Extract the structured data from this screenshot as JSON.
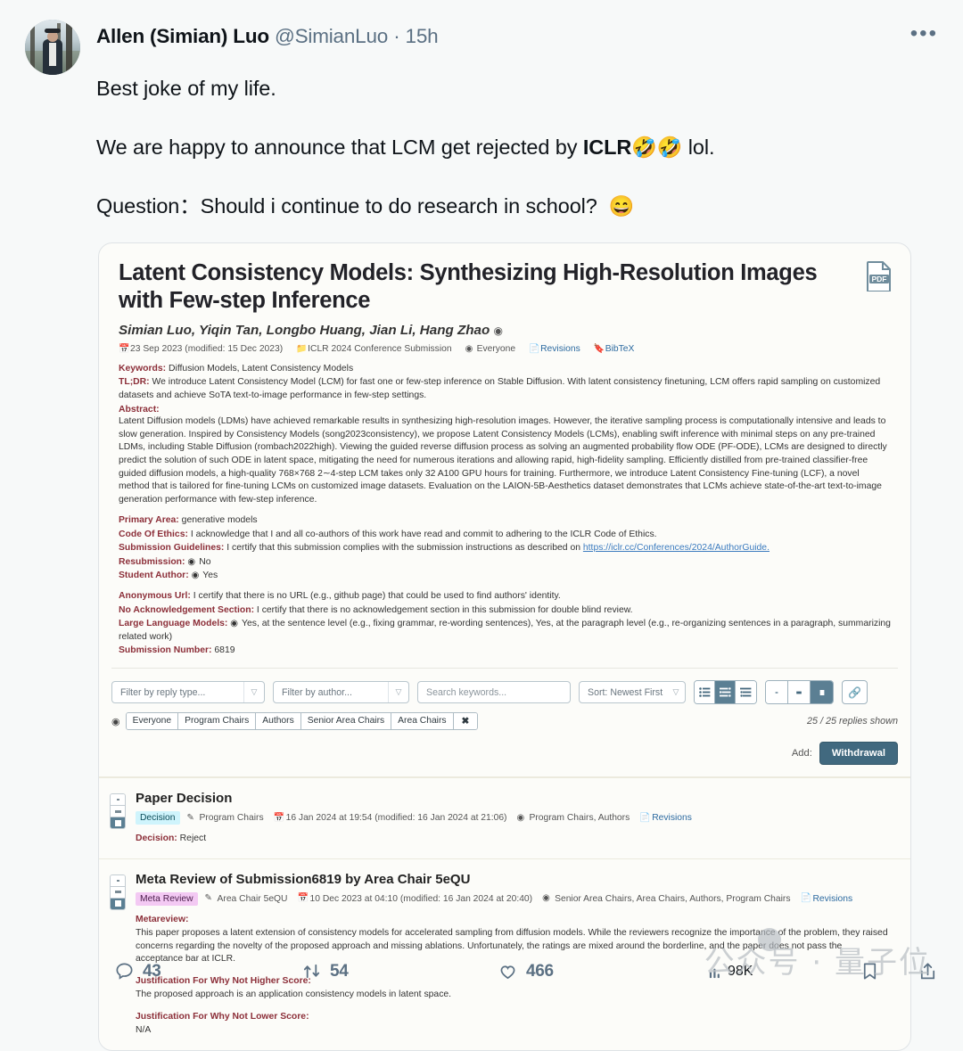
{
  "tweet": {
    "author_name": "Allen (Simian) Luo",
    "handle": "@SimianLuo",
    "separator": "·",
    "timestamp": "15h",
    "more_label": "•••",
    "line1": "Best joke of my life.",
    "line2_prefix": "We are happy to announce that LCM get rejected by ",
    "line2_bold": "ICLR",
    "line2_emoji": "🤣🤣",
    "line2_suffix": " lol.",
    "line3": "Question：Should i continue to do research in school?",
    "line3_emoji": "😄"
  },
  "paper": {
    "title": "Latent Consistency Models: Synthesizing High-Resolution Images with Few-step Inference",
    "authors": "Simian Luo, Yiqin Tan, Longbo Huang, Jian Li, Hang Zhao",
    "pdf_label": "PDF",
    "meta": {
      "date": "23 Sep 2023 (modified: 15 Dec 2023)",
      "venue": "ICLR 2024 Conference Submission",
      "readers": "Everyone",
      "revisions": "Revisions",
      "bibtex": "BibTeX"
    },
    "fields": [
      {
        "key": "Keywords:",
        "value": "Diffusion Models, Latent Consistency Models"
      },
      {
        "key": "TL;DR:",
        "value": "We introduce Latent Consistency Model (LCM) for fast one or few-step inference on Stable Diffusion. With latent consistency finetuning, LCM offers rapid sampling on customized datasets and achieve SoTA text-to-image performance in few-step settings."
      }
    ],
    "abstract_label": "Abstract:",
    "abstract": "Latent Diffusion models (LDMs) have achieved remarkable results in synthesizing high-resolution images. However, the iterative sampling process is computationally intensive and leads to slow generation. Inspired by Consistency Models (song2023consistency), we propose Latent Consistency Models (LCMs), enabling swift inference with minimal steps on any pre-trained LDMs, including Stable Diffusion (rombach2022high). Viewing the guided reverse diffusion process as solving an augmented probability flow ODE (PF-ODE), LCMs are designed to directly predict the solution of such ODE in latent space, mitigating the need for numerous iterations and allowing rapid, high-fidelity sampling. Efficiently distilled from pre-trained classifier-free guided diffusion models, a high-quality 768×768 2∼4-step LCM takes only 32 A100 GPU hours for training. Furthermore, we introduce Latent Consistency Fine-tuning (LCF), a novel method that is tailored for fine-tuning LCMs on customized image datasets. Evaluation on the LAION-5B-Aesthetics dataset demonstrates that LCMs achieve state-of-the-art text-to-image generation performance with few-step inference.",
    "fields2": [
      {
        "key": "Primary Area:",
        "value": "generative models"
      },
      {
        "key": "Code Of Ethics:",
        "value": "I acknowledge that I and all co-authors of this work have read and commit to adhering to the ICLR Code of Ethics."
      },
      {
        "key": "Submission Guidelines:",
        "value": "I certify that this submission complies with the submission instructions as described on ",
        "link": "https://iclr.cc/Conferences/2024/AuthorGuide."
      },
      {
        "key": "Resubmission:",
        "value": "No",
        "eye": true
      },
      {
        "key": "Student Author:",
        "value": "Yes",
        "eye": true
      }
    ],
    "fields3": [
      {
        "key": "Anonymous Url:",
        "value": "I certify that there is no URL (e.g., github page) that could be used to find authors' identity."
      },
      {
        "key": "No Acknowledgement Section:",
        "value": "I certify that there is no acknowledgement section in this submission for double blind review."
      },
      {
        "key": "Large Language Models:",
        "value": "Yes, at the sentence level (e.g., fixing grammar, re-wording sentences), Yes, at the paragraph level (e.g., re-organizing sentences in a paragraph, summarizing related work)",
        "eye": true
      },
      {
        "key": "Submission Number:",
        "value": "6819"
      }
    ]
  },
  "toolbar": {
    "filter_reply_type_placeholder": "Filter by reply type...",
    "filter_author_placeholder": "Filter by author...",
    "search_placeholder": "Search keywords...",
    "sort_value": "Sort: Newest First",
    "chips": [
      "Everyone",
      "Program Chairs",
      "Authors",
      "Senior Area Chairs",
      "Area Chairs"
    ],
    "chip_clear": "✖",
    "replies_shown": "25 / 25 replies shown",
    "add_label": "Add:",
    "withdrawal_label": "Withdrawal"
  },
  "discussion": [
    {
      "title": "Paper Decision",
      "badge": "Decision",
      "badge_type": "decision",
      "signature": "Program Chairs",
      "date": "16 Jan 2024 at 19:54 (modified: 16 Jan 2024 at 21:06)",
      "readers": "Program Chairs, Authors",
      "revisions": "Revisions",
      "sections": [
        {
          "label": "Decision:",
          "text": "Reject",
          "inline": true
        }
      ]
    },
    {
      "title": "Meta Review of Submission6819 by Area Chair 5eQU",
      "badge": "Meta Review",
      "badge_type": "meta",
      "signature": "Area Chair 5eQU",
      "date": "10 Dec 2023 at 04:10 (modified: 16 Jan 2024 at 20:40)",
      "readers": "Senior Area Chairs, Area Chairs, Authors, Program Chairs",
      "revisions": "Revisions",
      "sections": [
        {
          "label": "Metareview:",
          "text": "This paper proposes a latent extension of consistency models for accelerated sampling from diffusion models. While the reviewers recognize the importance of the problem, they raised concerns regarding the novelty of the proposed approach and missing ablations. Unfortunately, the ratings are mixed around the borderline, and the paper does not pass the acceptance bar at ICLR.",
          "inline": false
        },
        {
          "label": "Justification For Why Not Higher Score:",
          "text": "The proposed approach is an application consistency models in latent space.",
          "inline": false
        },
        {
          "label": "Justification For Why Not Lower Score:",
          "text": "N/A",
          "inline": false
        }
      ]
    }
  ],
  "actions": {
    "reply_count": "43",
    "retweet_count": "54",
    "like_count": "466",
    "view_count": "98K"
  },
  "watermark": "公众号 · 量子位",
  "colors": {
    "page_bg": "#f7f9f9",
    "card_bg": "#fcfcf9",
    "accent_red": "#8c2f39",
    "link_blue": "#2c6aa0",
    "muted": "#5b7083",
    "button_blue": "#41697f",
    "badge_decision": "#cff4fc",
    "badge_meta": "#f3c9f3"
  }
}
